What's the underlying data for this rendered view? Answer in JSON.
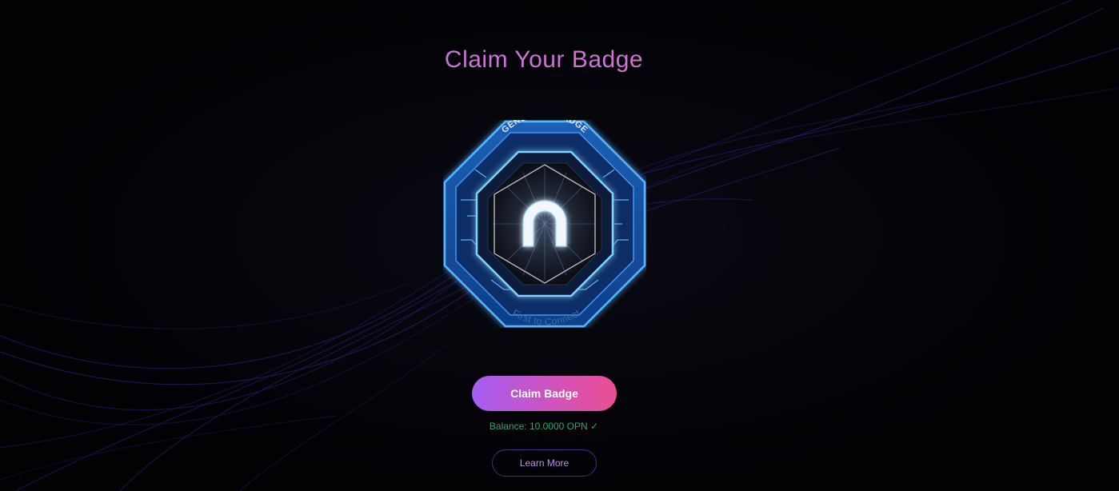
{
  "page": {
    "title": "Claim Your Badge"
  },
  "badge": {
    "top_text": "GENESIS ∩-BADGE",
    "bottom_text": "First to Connect",
    "icon": "n-logo-icon"
  },
  "actions": {
    "claim_label": "Claim Badge",
    "balance_text": "Balance: 10.0000 OPN ✓",
    "learn_more_label": "Learn More"
  },
  "colors": {
    "background": "#020205",
    "title_gradient_start": "#b57be8",
    "title_gradient_end": "#e070c0",
    "claim_gradient_start": "#a45ef3",
    "claim_gradient_end": "#ea4f91",
    "balance_text": "#2fa865",
    "learn_more_border": "#4b2a86",
    "badge_glow": "#2f8cff"
  }
}
